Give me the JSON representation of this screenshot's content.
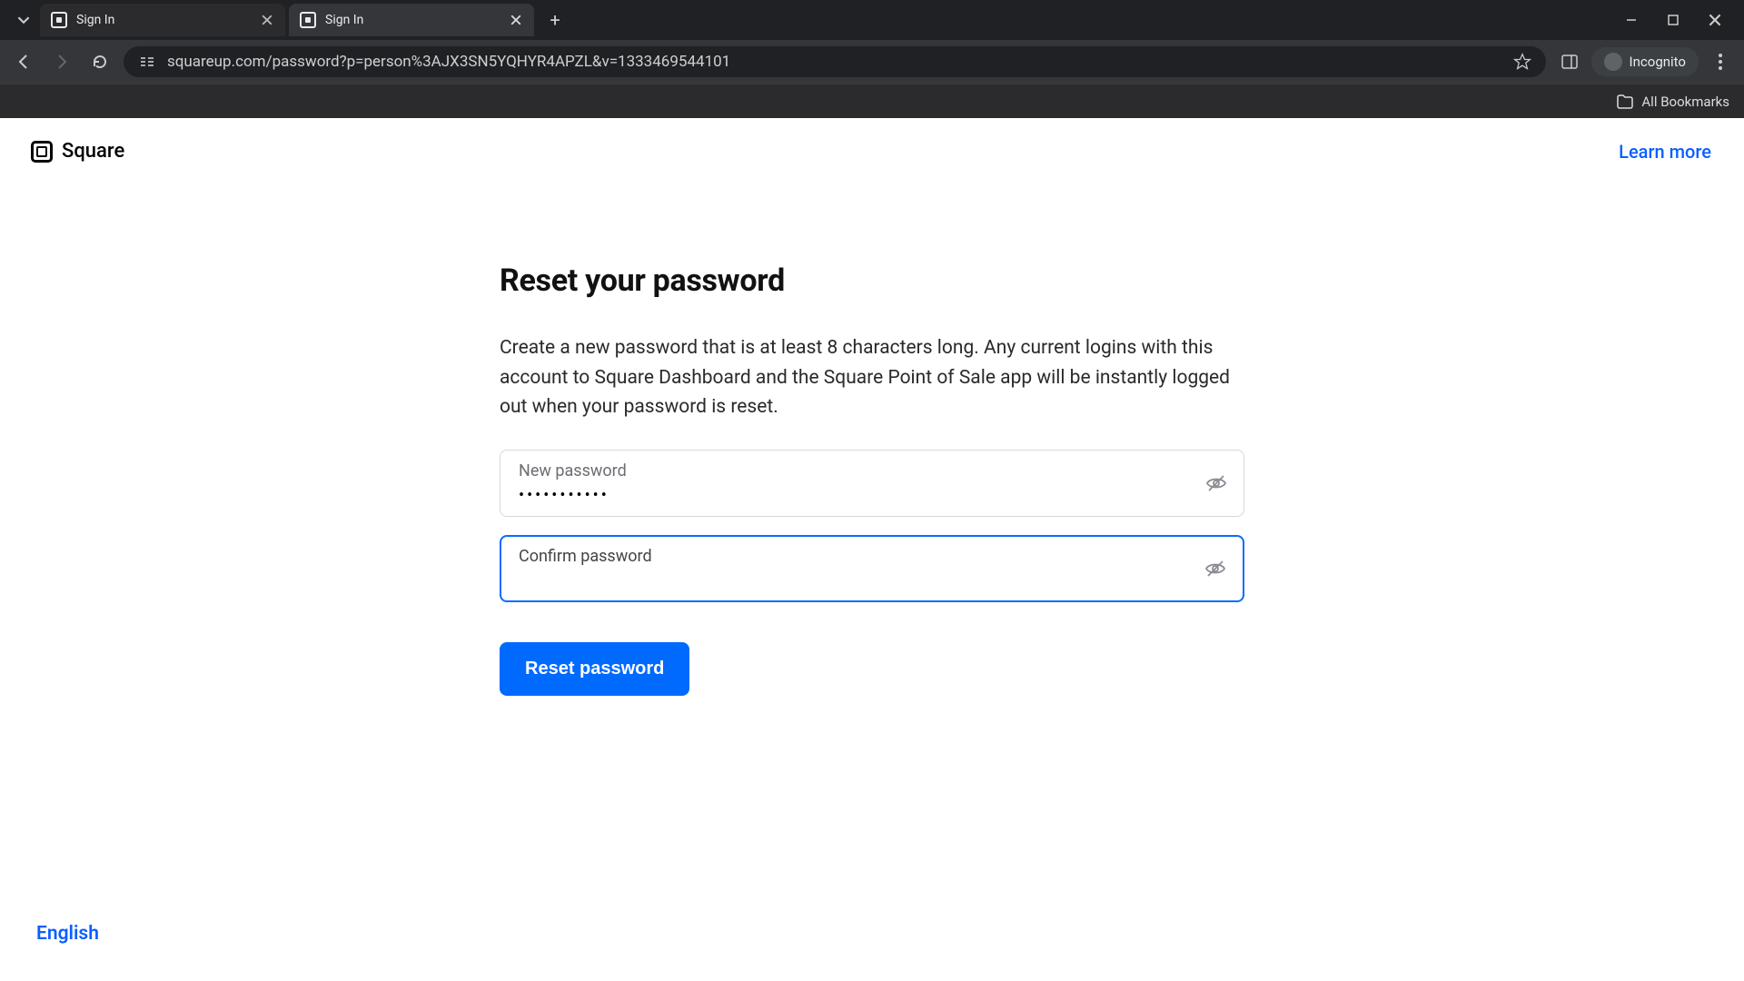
{
  "browser": {
    "tabs": [
      {
        "title": "Sign In"
      },
      {
        "title": "Sign In"
      }
    ],
    "url": "squareup.com/password?p=person%3AJX3SN5YQHYR4APZL&v=1333469544101",
    "incognito_label": "Incognito",
    "bookmarks_label": "All Bookmarks"
  },
  "header": {
    "brand": "Square",
    "learn_more": "Learn more"
  },
  "form": {
    "title": "Reset your password",
    "description": "Create a new password that is at least 8 characters long. Any current logins with this account to Square Dashboard and the Square Point of Sale app will be instantly logged out when your password is reset.",
    "new_password_label": "New password",
    "new_password_value": "•••••••••••",
    "confirm_password_label": "Confirm password",
    "confirm_password_value": "",
    "submit_label": "Reset password"
  },
  "footer": {
    "language": "English"
  }
}
